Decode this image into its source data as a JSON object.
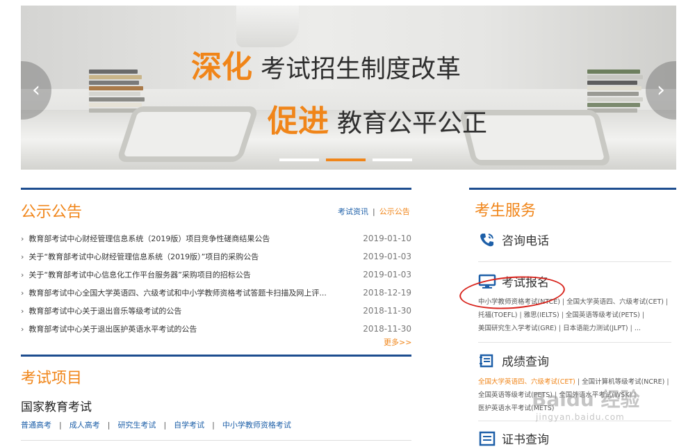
{
  "banner": {
    "line1_emphasis": "深化",
    "line1_text": "考试招生制度改革",
    "line2_emphasis": "促进",
    "line2_text": "教育公平公正",
    "prev_glyph": "‹",
    "next_glyph": "›",
    "slide_count": 3,
    "active_slide": 2,
    "accent_color": "#f08519"
  },
  "announcement": {
    "title": "公示公告",
    "tabs": [
      "考试资讯",
      "公示公告"
    ],
    "tab_separator": "|",
    "active_tab": "公示公告",
    "items": [
      {
        "title": "教育部考试中心财经管理信息系统（2019版）项目竞争性磋商结果公告",
        "date": "2019-01-10"
      },
      {
        "title": "关于“教育部考试中心财经管理信息系统（2019版）”项目的采购公告",
        "date": "2019-01-03"
      },
      {
        "title": "关于“教育部考试中心信息化工作平台服务器”采购项目的招标公告",
        "date": "2019-01-03"
      },
      {
        "title": "教育部考试中心全国大学英语四、六级考试和中小学教师资格考试答题卡扫描及网上评...",
        "date": "2018-12-19"
      },
      {
        "title": "教育部考试中心关于退出音乐等级考试的公告",
        "date": "2018-11-30"
      },
      {
        "title": "教育部考试中心关于退出医护英语水平考试的公告",
        "date": "2018-11-30"
      }
    ],
    "more": "更多>>"
  },
  "exam_projects": {
    "title": "考试项目",
    "subtitle": "国家教育考试",
    "links": [
      "普通高考",
      "成人高考",
      "研究生考试",
      "自学考试",
      "中小学教师资格考试"
    ],
    "separator": "|"
  },
  "services": {
    "title": "考生服务",
    "consult": {
      "label": "咨询电话",
      "icon": "phone-icon"
    },
    "register": {
      "label": "考试报名",
      "icon": "monitor-icon",
      "lines": [
        [
          "中小学教师资格考试(NTCE)",
          "全国大学英语四、六级考试(CET)"
        ],
        [
          "托福(TOEFL)",
          "雅思(IELTS)",
          "全国英语等级考试(PETS)"
        ],
        [
          "美国研究生入学考试(GRE)",
          "日本语能力测试(JLPT)",
          "..."
        ]
      ]
    },
    "scores": {
      "label": "成绩查询",
      "icon": "notebook-icon",
      "highlight": "全国大学英语四、六级考试(CET)",
      "lines": [
        [
          "全国大学英语四、六级考试(CET)",
          "全国计算机等级考试(NCRE)"
        ],
        [
          "全国英语等级考试(PETS)",
          "全国外语水平考试(WSK)"
        ],
        [
          "医护英语水平考试(METS)"
        ]
      ]
    },
    "certificate": {
      "label": "证书查询",
      "icon": "certificate-icon"
    },
    "separator": "|"
  },
  "watermark": {
    "line1": "Baidu 经验",
    "line2": "jingyan.baidu.com"
  },
  "colors": {
    "orange": "#f08519",
    "navy": "#1d4d8f",
    "link_blue": "#1d5fa8",
    "annotation_red": "#d8231c"
  }
}
